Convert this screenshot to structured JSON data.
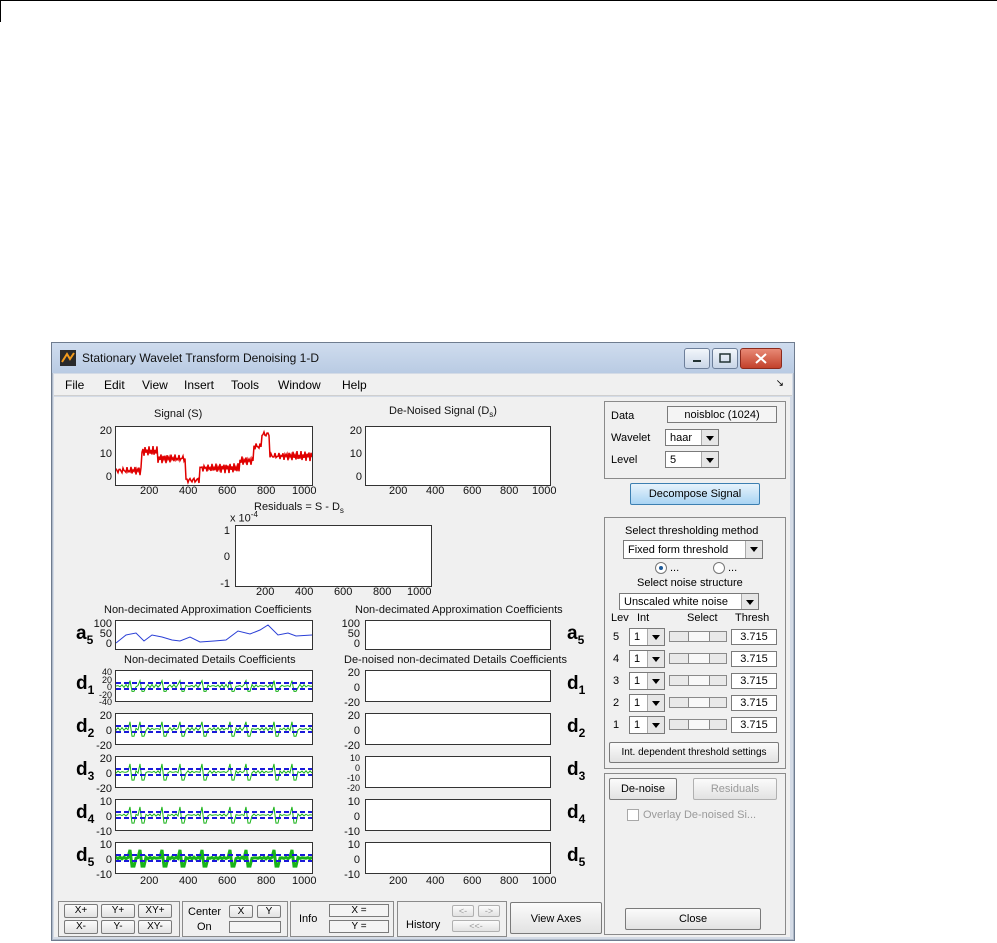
{
  "window": {
    "title": "Stationary Wavelet Transform Denoising 1-D"
  },
  "menu": [
    "File",
    "Edit",
    "View",
    "Insert",
    "Tools",
    "Window",
    "Help"
  ],
  "plots": {
    "signal_title": "Signal (S)",
    "denoised_title_main": "De-Noised Signal (D",
    "denoised_title_sub": "s",
    "denoised_title_end": ")",
    "residuals_title_main": "Residuals = S - D",
    "residuals_title_sub": "s",
    "residuals_exponent_label": "x 10",
    "residuals_exponent_power": "-4",
    "approx_left_title": "Non-decimated Approximation Coefficients",
    "approx_right_title": "Non-decimated Approximation Coefficients",
    "details_left_title": "Non-decimated Details Coefficients",
    "details_right_title": "De-noised non-decimated Details Coefficients",
    "signal_yticks": [
      "20",
      "10",
      "0"
    ],
    "residual_yticks": [
      "1",
      "0",
      "-1"
    ],
    "xticks": [
      "200",
      "400",
      "600",
      "800",
      "1000"
    ],
    "a5_yticks": [
      "100",
      "50",
      "0"
    ],
    "d5_left_yticks": [
      "40",
      "20",
      "0",
      "-20",
      "-40"
    ],
    "d5_right_yticks": [
      "20",
      "0",
      "-20"
    ],
    "d4_yticks": [
      "20",
      "0",
      "-20"
    ],
    "d3_left_yticks": [
      "20",
      "0",
      "-20"
    ],
    "d3_right_yticks": [
      "10",
      "0",
      "-10",
      "-20"
    ],
    "d2_yticks": [
      "10",
      "0",
      "-10"
    ],
    "d1_yticks": [
      "10",
      "0",
      "-10"
    ],
    "coef_letters": {
      "a": "a",
      "d": "d"
    },
    "levels": [
      "5",
      "4",
      "3",
      "2",
      "1"
    ]
  },
  "colors": {
    "signal": "#e00000",
    "approx": "#2a3fd6",
    "detail": "#19b319",
    "threshold": "#1a1ad9"
  },
  "right_panel": {
    "data_label": "Data",
    "data_value": "noisbloc  (1024)",
    "wavelet_label": "Wavelet",
    "wavelet_value": "haar",
    "level_label": "Level",
    "level_value": "5",
    "decompose_button": "Decompose Signal",
    "select_method_label": "Select thresholding method",
    "method_value": "Fixed form threshold",
    "radio1_label": "...",
    "radio2_label": "...",
    "noise_label": "Select noise structure",
    "noise_value": "Unscaled white noise",
    "col_lev": "Lev",
    "col_int": "Int",
    "col_select": "Select",
    "col_thresh": "Thresh",
    "rows": [
      {
        "lev": "5",
        "int": "1",
        "thresh": "3.715"
      },
      {
        "lev": "4",
        "int": "1",
        "thresh": "3.715"
      },
      {
        "lev": "3",
        "int": "1",
        "thresh": "3.715"
      },
      {
        "lev": "2",
        "int": "1",
        "thresh": "3.715"
      },
      {
        "lev": "1",
        "int": "1",
        "thresh": "3.715"
      }
    ],
    "int_dep_button": "Int. dependent threshold settings",
    "denoise_button": "De-noise",
    "residuals_button": "Residuals",
    "overlay_label": "Overlay De-noised Si...",
    "close_button": "Close"
  },
  "bottom_bar": {
    "xplus": "X+",
    "yplus": "Y+",
    "xyplus": "XY+",
    "xminus": "X-",
    "yminus": "Y-",
    "xyminus": "XY-",
    "center_label": "Center",
    "on_label": "On",
    "x_btn": "X",
    "y_btn": "Y",
    "info_label": "Info",
    "x_readout": "X =",
    "y_readout": "Y =",
    "history_label": "History",
    "hist_prev": "<-",
    "hist_next": "->",
    "hist_first": "<<-",
    "view_axes": "View Axes"
  }
}
